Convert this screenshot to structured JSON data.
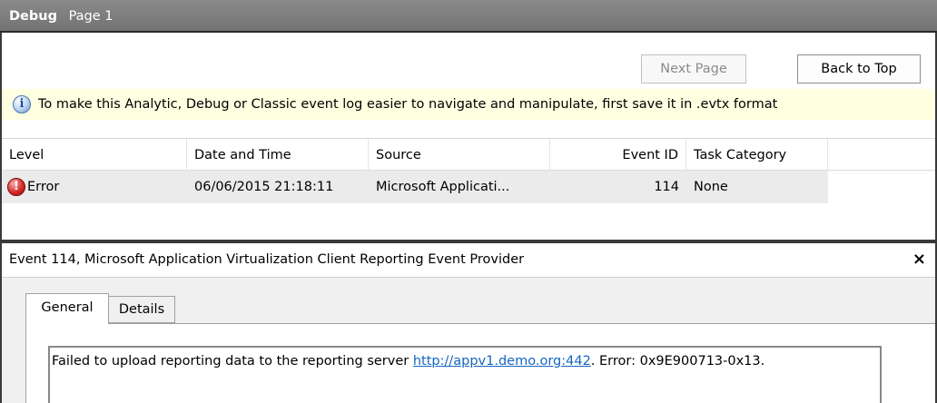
{
  "window": {
    "title": "Debug",
    "subtitle": "Page 1"
  },
  "toolbar": {
    "next_page_label": "Next Page",
    "back_to_top_label": "Back to Top"
  },
  "info_bar": {
    "icon": "info-icon",
    "message": "To make this Analytic, Debug or Classic event log easier to navigate and manipulate, first save it in .evtx format"
  },
  "grid": {
    "columns": [
      "Level",
      "Date and Time",
      "Source",
      "Event ID",
      "Task Category"
    ],
    "rows": [
      {
        "level_icon": "error-icon",
        "level": "Error",
        "date_time": "06/06/2015 21:18:11",
        "source": "Microsoft Applicati...",
        "event_id": "114",
        "task_category": "None"
      }
    ]
  },
  "details_pane": {
    "title": "Event 114, Microsoft Application Virtualization Client Reporting Event Provider",
    "close_label": "×",
    "tabs": [
      "General",
      "Details"
    ],
    "active_tab": "General",
    "message_before_link": "Failed to upload reporting data to the reporting server ",
    "message_link": "http://appv1.demo.org:442",
    "message_after_link": ". Error: 0x9E900713-0x13."
  },
  "colors": {
    "title_bar": "#7f7f7f",
    "info_bar_bg": "#ffffe1",
    "selected_row_bg": "#ebebeb",
    "link": "#1565c0",
    "error_icon": "#d62a2a"
  }
}
